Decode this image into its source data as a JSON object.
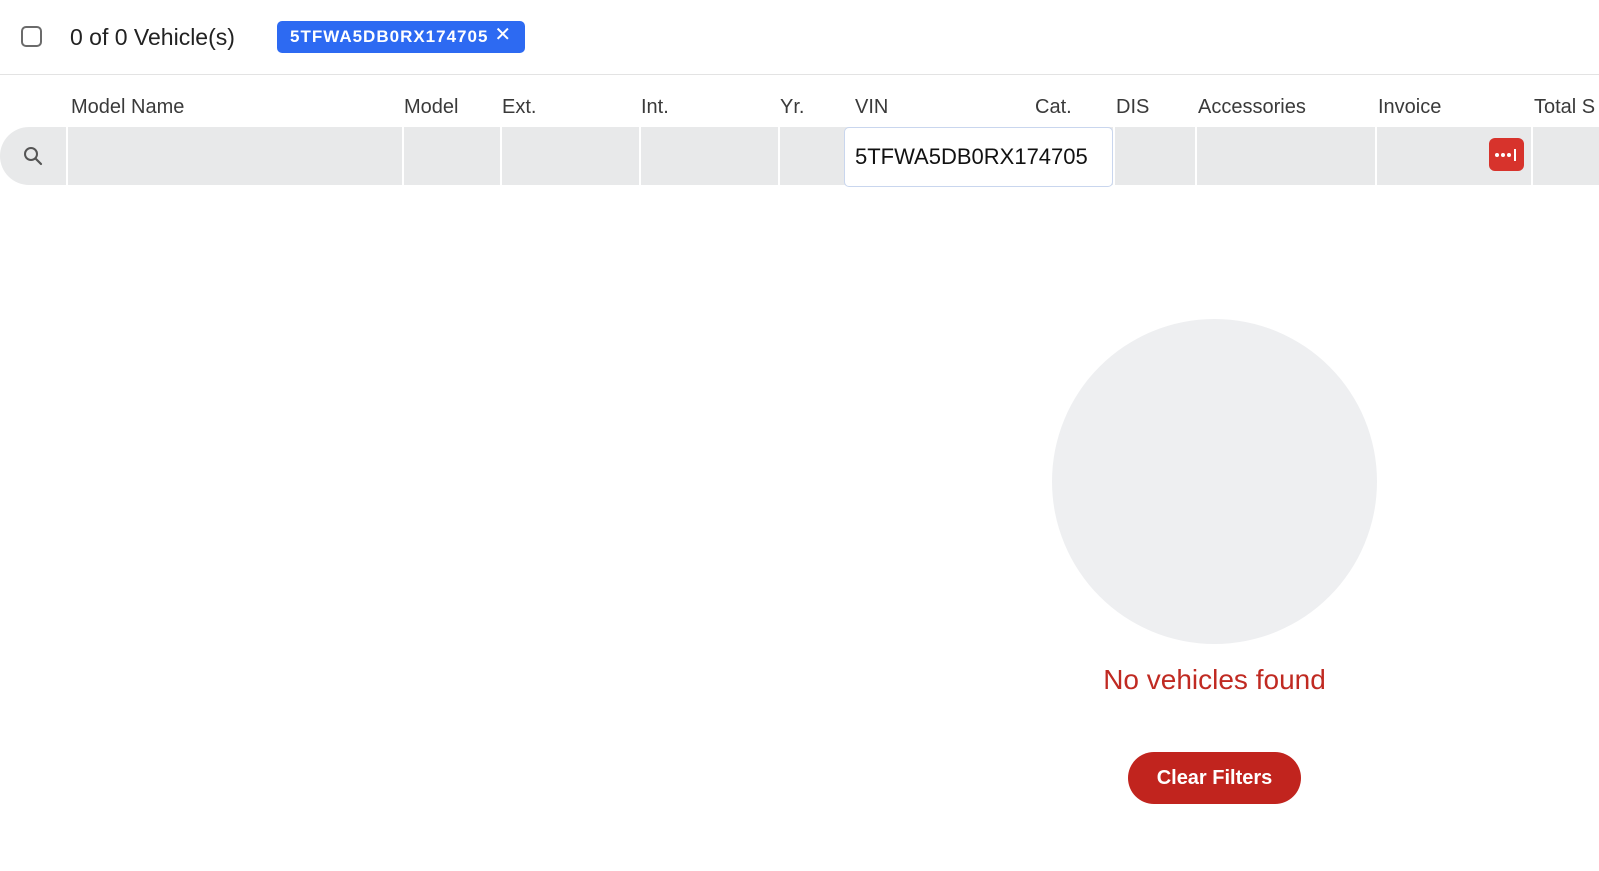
{
  "topbar": {
    "count_label": "0 of 0 Vehicle(s)",
    "filter_chip": {
      "label": "5TFWA5DB0RX174705",
      "close_glyph": "✕"
    }
  },
  "table": {
    "columns": [
      "Model Name",
      "Model",
      "Ext.",
      "Int.",
      "Yr.",
      "VIN",
      "Cat.",
      "DIS",
      "Accessories",
      "Invoice",
      "Total S"
    ],
    "filters": {
      "vin_value": "5TFWA5DB0RX174705"
    }
  },
  "icons": {
    "search": "search-icon",
    "menu": "more-options-icon"
  },
  "colors": {
    "chip": "#2d6af2",
    "accent_red": "#c1241e",
    "filter_bg": "#e8e9ea"
  },
  "empty_state": {
    "message": "No vehicles found",
    "clear_label": "Clear Filters"
  }
}
